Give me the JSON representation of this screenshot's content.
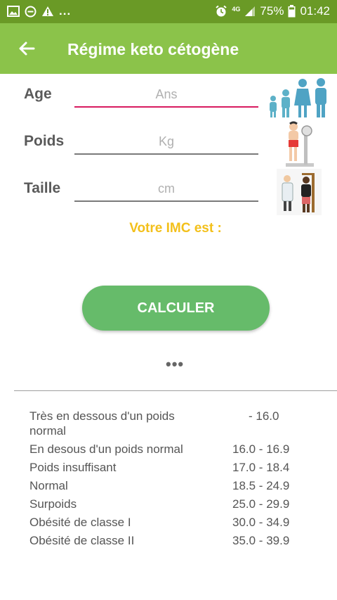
{
  "status_bar": {
    "left_icons": [
      "image-icon",
      "minus-circle-icon",
      "warning-icon"
    ],
    "ellipsis": "...",
    "network": "4G",
    "battery": "75%",
    "time": "01:42"
  },
  "app_bar": {
    "back_icon": "arrow-left-icon",
    "title": "Régime keto cétogène"
  },
  "form": {
    "age": {
      "label": "Age",
      "placeholder": "Ans",
      "value": "",
      "illustration": "family-icon"
    },
    "poids": {
      "label": "Poids",
      "placeholder": "Kg",
      "value": "",
      "illustration": "weighing-scale-icon"
    },
    "taille": {
      "label": "Taille",
      "placeholder": "cm",
      "value": "",
      "illustration": "height-measure-icon"
    }
  },
  "result_label": "Votre IMC est :",
  "calc_button": "CALCULER",
  "more": "•••",
  "imc_table": [
    {
      "label": "Très en dessous d'un poids normal",
      "range": "- 16.0"
    },
    {
      "label": "En desous d'un poids normal",
      "range": "16.0 - 16.9"
    },
    {
      "label": "Poids insuffisant",
      "range": "17.0 - 18.4"
    },
    {
      "label": "Normal",
      "range": "18.5 - 24.9"
    },
    {
      "label": "Surpoids",
      "range": "25.0 - 29.9"
    },
    {
      "label": "Obésité de classe I",
      "range": "30.0 - 34.9"
    },
    {
      "label": "Obésité de classe II",
      "range": "35.0 - 39.9"
    }
  ],
  "colors": {
    "status_bar": "#6a9a26",
    "app_bar": "#8bc34a",
    "accent_field": "#d81b60",
    "result_text": "#f3c01b",
    "button": "#66bb6a"
  }
}
